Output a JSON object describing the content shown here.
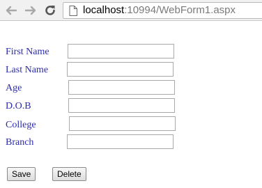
{
  "browser": {
    "back_icon": "arrow-left-icon",
    "forward_icon": "arrow-right-icon",
    "reload_icon": "reload-icon",
    "page_icon": "page-icon",
    "url_host": "localhost",
    "url_rest": ":10994/WebForm1.aspx"
  },
  "form": {
    "label_color": "#2b2bb0",
    "fields": [
      {
        "label": "First Name",
        "value": ""
      },
      {
        "label": "Last Name",
        "value": ""
      },
      {
        "label": "Age",
        "value": ""
      },
      {
        "label": "D.O.B",
        "value": ""
      },
      {
        "label": "College",
        "value": ""
      },
      {
        "label": "Branch",
        "value": ""
      }
    ],
    "save_label": "Save",
    "delete_label": "Delete"
  }
}
